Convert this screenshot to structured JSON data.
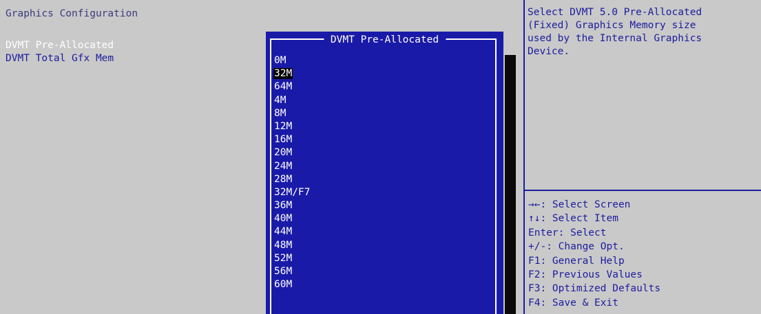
{
  "page": {
    "section_title": "Graphics Configuration"
  },
  "settings": [
    {
      "label": "DVMT Pre-Allocated",
      "selected": true
    },
    {
      "label": "DVMT Total Gfx Mem",
      "selected": false
    }
  ],
  "help": {
    "lines": [
      "Select DVMT 5.0 Pre-Allocated",
      "(Fixed) Graphics Memory size",
      "used by the Internal Graphics",
      "Device."
    ]
  },
  "keys": [
    "→←: Select Screen",
    "↑↓: Select Item",
    "Enter: Select",
    "+/-: Change Opt.",
    "F1: General Help",
    "F2: Previous Values",
    "F3: Optimized Defaults",
    "F4: Save & Exit"
  ],
  "popup": {
    "title": "DVMT Pre-Allocated",
    "selected_option": "32M",
    "options": [
      "0M",
      "32M",
      "64M",
      "4M",
      "8M",
      "12M",
      "16M",
      "20M",
      "24M",
      "28M",
      "32M/F7",
      "36M",
      "40M",
      "44M",
      "48M",
      "52M",
      "56M",
      "60M"
    ]
  },
  "colors": {
    "background": "#c9c9c9",
    "text_blue": "#1c1c9e",
    "popup_blue": "#1a1aa8",
    "highlight": "#ffffff"
  }
}
